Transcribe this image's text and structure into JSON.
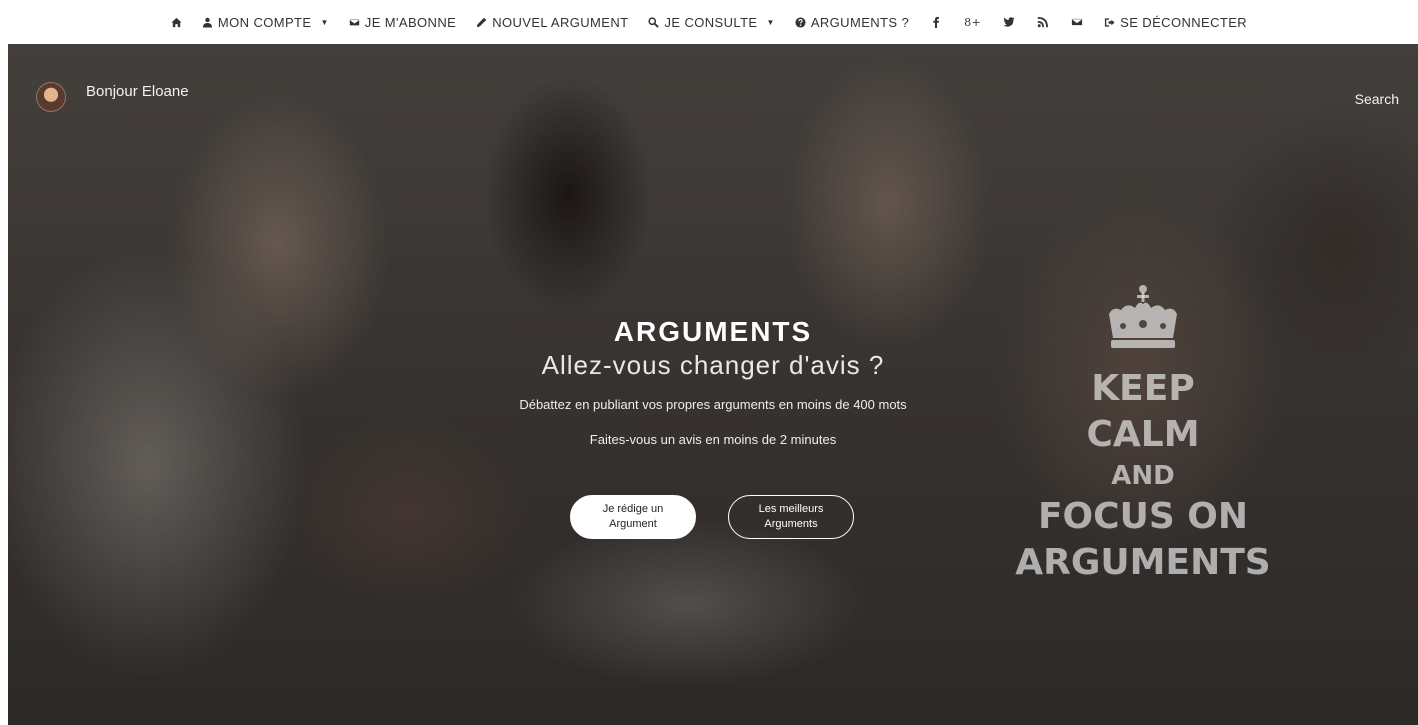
{
  "nav": {
    "items": [
      {
        "label": "Mon compte",
        "icon": "user-icon",
        "dropdown": true
      },
      {
        "label": "Je m'abonne",
        "icon": "envelope-icon",
        "dropdown": false
      },
      {
        "label": "Nouvel argument",
        "icon": "pencil-icon",
        "dropdown": false
      },
      {
        "label": "Je consulte",
        "icon": "search-icon",
        "dropdown": true
      },
      {
        "label": "Arguments ?",
        "icon": "question-circle-icon",
        "dropdown": false
      }
    ],
    "social": [
      "facebook-icon",
      "google-plus-icon",
      "twitter-icon",
      "rss-icon",
      "mail-icon"
    ],
    "logout_label": "Se déconnecter",
    "caret": "▼",
    "gplus_glyph": "8+"
  },
  "user": {
    "greeting": "Bonjour Eloane"
  },
  "search": {
    "label": "Search"
  },
  "hero": {
    "title": "ARGUMENTS",
    "subtitle": "Allez-vous changer d'avis ?",
    "line1": "Débattez en publiant vos propres arguments en moins de 400 mots",
    "line2": "Faites-vous un avis en moins de 2 minutes",
    "button_primary": "Je rédige un Argument",
    "button_secondary": "Les meilleurs Arguments"
  },
  "poster": {
    "line1": "KEEP",
    "line2": "CALM",
    "line3": "AND",
    "line4": "FOCUS ON",
    "line5": "ARGUMENTS"
  },
  "colors": {
    "nav_text": "#333333",
    "hero_text": "#ffffff",
    "button_bg": "#ffffff"
  }
}
